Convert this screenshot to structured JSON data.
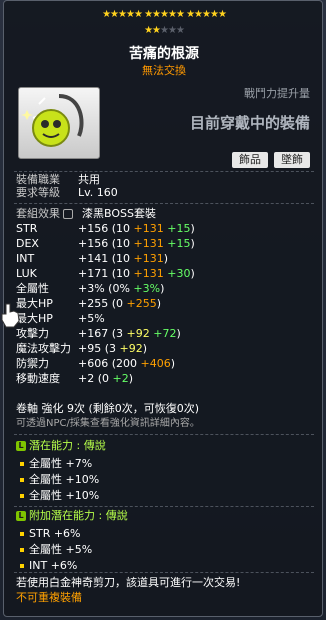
{
  "stars": {
    "row1_filled": 15,
    "row1_empty": 0,
    "row2_filled": 2,
    "row2_empty": 3
  },
  "item": {
    "name": "苦痛的根源",
    "trade": "無法交換"
  },
  "power": {
    "label": "戰鬥力提升量",
    "value": "目前穿戴中的裝備"
  },
  "tags": [
    "飾品",
    "墜飾"
  ],
  "info": [
    {
      "label": "裝備職業",
      "value": "共用"
    },
    {
      "label": "要求等級",
      "value": "Lv. 160"
    }
  ],
  "set": {
    "label": "套組效果",
    "value": "漆黑BOSS套裝"
  },
  "stats": [
    {
      "name": "STR",
      "parts": [
        {
          "t": "+156 ",
          "c": "w"
        },
        {
          "t": "(10 ",
          "c": "w"
        },
        {
          "t": "+131 ",
          "c": "o"
        },
        {
          "t": "+15",
          "c": "g"
        },
        {
          "t": ")",
          "c": "w"
        }
      ]
    },
    {
      "name": "DEX",
      "parts": [
        {
          "t": "+156 ",
          "c": "w"
        },
        {
          "t": "(10 ",
          "c": "w"
        },
        {
          "t": "+131 ",
          "c": "o"
        },
        {
          "t": "+15",
          "c": "g"
        },
        {
          "t": ")",
          "c": "w"
        }
      ]
    },
    {
      "name": "INT",
      "parts": [
        {
          "t": "+141 ",
          "c": "w"
        },
        {
          "t": "(10 ",
          "c": "w"
        },
        {
          "t": "+131",
          "c": "o"
        },
        {
          "t": ")",
          "c": "w"
        }
      ]
    },
    {
      "name": "LUK",
      "parts": [
        {
          "t": "+171 ",
          "c": "w"
        },
        {
          "t": "(10 ",
          "c": "w"
        },
        {
          "t": "+131 ",
          "c": "o"
        },
        {
          "t": "+30",
          "c": "g"
        },
        {
          "t": ")",
          "c": "w"
        }
      ]
    },
    {
      "name": "全屬性",
      "parts": [
        {
          "t": "+3% ",
          "c": "w"
        },
        {
          "t": "(0% ",
          "c": "w"
        },
        {
          "t": "+3%",
          "c": "g"
        },
        {
          "t": ")",
          "c": "w"
        }
      ]
    },
    {
      "name": "最大HP",
      "parts": [
        {
          "t": "+255 ",
          "c": "w"
        },
        {
          "t": "(0 ",
          "c": "w"
        },
        {
          "t": "+255",
          "c": "o"
        },
        {
          "t": ")",
          "c": "w"
        }
      ]
    },
    {
      "name": "最大HP",
      "parts": [
        {
          "t": "+5%",
          "c": "w"
        }
      ]
    },
    {
      "name": "攻擊力",
      "parts": [
        {
          "t": "+167 ",
          "c": "w"
        },
        {
          "t": "(3 ",
          "c": "w"
        },
        {
          "t": "+92 ",
          "c": "y"
        },
        {
          "t": "+72",
          "c": "g"
        },
        {
          "t": ")",
          "c": "w"
        }
      ]
    },
    {
      "name": "魔法攻擊力",
      "parts": [
        {
          "t": "+95 ",
          "c": "w"
        },
        {
          "t": "(3 ",
          "c": "w"
        },
        {
          "t": "+92",
          "c": "y"
        },
        {
          "t": ")",
          "c": "w"
        }
      ]
    },
    {
      "name": "防禦力",
      "parts": [
        {
          "t": "+606 ",
          "c": "w"
        },
        {
          "t": "(200 ",
          "c": "w"
        },
        {
          "t": "+406",
          "c": "o"
        },
        {
          "t": ")",
          "c": "w"
        }
      ]
    },
    {
      "name": "移動速度",
      "parts": [
        {
          "t": "+2 ",
          "c": "w"
        },
        {
          "t": "(0 ",
          "c": "w"
        },
        {
          "t": "+2",
          "c": "g"
        },
        {
          "t": ")",
          "c": "w"
        }
      ]
    }
  ],
  "scroll": "卷軸 強化 9次 (剩餘0次，可恢復0次)",
  "npc_note": "可透過NPC/採集查看強化資訊詳細內容。",
  "potential": {
    "header": "潛在能力 : 傳說",
    "lines": [
      "全屬性 +7%",
      "全屬性 +10%",
      "全屬性 +10%"
    ]
  },
  "bonus_potential": {
    "header": "附加潛在能力 : 傳說",
    "lines": [
      "STR +6%",
      "全屬性 +5%",
      "INT +6%"
    ]
  },
  "footer": {
    "note": "若使用白金神奇剪刀，該道具可進行一次交易!",
    "warn": "不可重複裝備"
  },
  "colors": {
    "orange": "#ff9900",
    "green": "#66ff66",
    "legend_green": "#b6ff4a"
  }
}
